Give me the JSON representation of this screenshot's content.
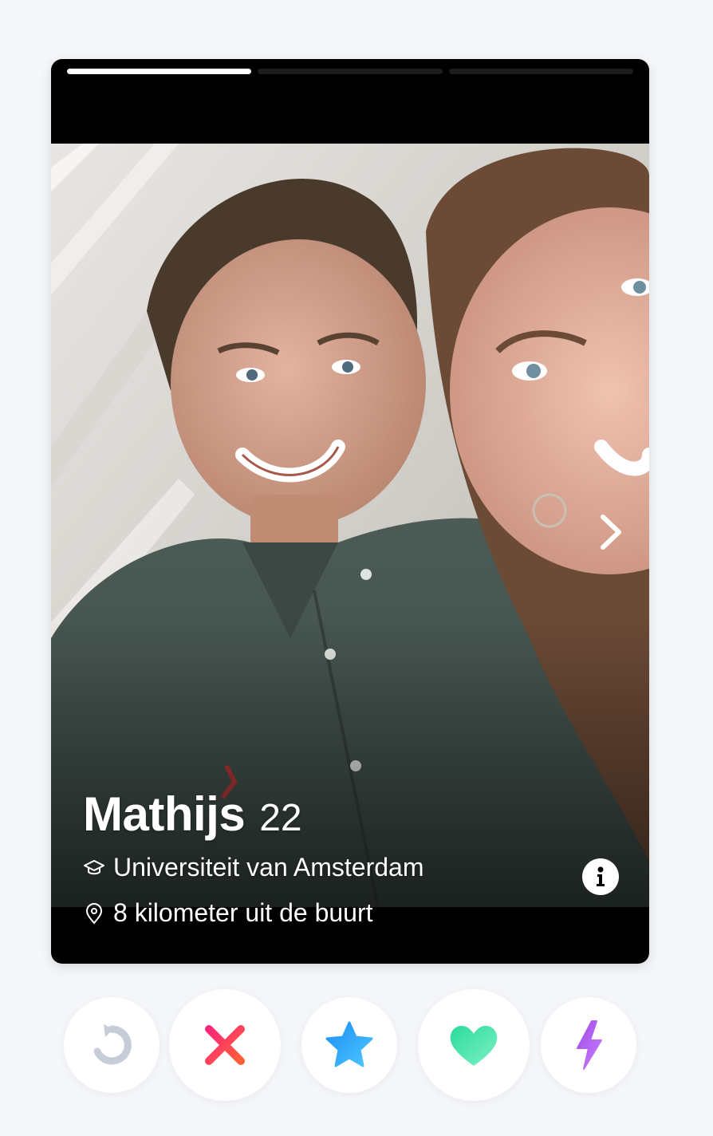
{
  "profile": {
    "name": "Mathijs",
    "age": "22",
    "school": "Universiteit van Amsterdam",
    "distance": "8 kilometer uit de buurt"
  },
  "photos": {
    "count": 3,
    "current_index": 1
  },
  "icons": {
    "school": "graduation-cap-icon",
    "location": "map-pin-icon",
    "info": "info-icon",
    "next": "chevron-right-icon"
  },
  "actions": [
    {
      "name": "rewind",
      "icon": "rewind-icon",
      "color": "#c6cdd8"
    },
    {
      "name": "nope",
      "icon": "x-icon",
      "colors": [
        "#fd267a",
        "#ff6036"
      ]
    },
    {
      "name": "super-like",
      "icon": "star-icon",
      "colors": [
        "#1e8ef5",
        "#4cc6ff"
      ]
    },
    {
      "name": "like",
      "icon": "heart-icon",
      "colors": [
        "#2bdc9c",
        "#7df0c3"
      ]
    },
    {
      "name": "boost",
      "icon": "lightning-icon",
      "colors": [
        "#a14ce5",
        "#c77dff"
      ]
    }
  ],
  "theme": {
    "background": "#f4f6fa",
    "card": "#000000",
    "progress_active": "#ffffff",
    "progress_inactive": "#1c1c1c"
  }
}
